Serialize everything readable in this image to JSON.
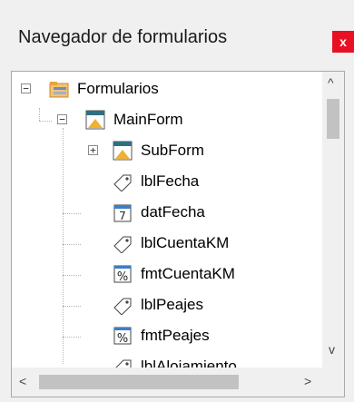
{
  "window": {
    "title": "Navegador de formularios",
    "close_glyph": "x"
  },
  "tree": {
    "items": [
      {
        "label": "Formularios",
        "icon": "folder-icon"
      },
      {
        "label": "MainForm",
        "icon": "form-icon"
      },
      {
        "label": "SubForm",
        "icon": "form-icon"
      },
      {
        "label": "lblFecha",
        "icon": "label-tag-icon"
      },
      {
        "label": "datFecha",
        "icon": "date-field-icon"
      },
      {
        "label": "lblCuentaKM",
        "icon": "label-tag-icon"
      },
      {
        "label": "fmtCuentaKM",
        "icon": "formatted-field-icon"
      },
      {
        "label": "lblPeajes",
        "icon": "label-tag-icon"
      },
      {
        "label": "fmtPeajes",
        "icon": "formatted-field-icon"
      },
      {
        "label": "lblAlojamiento",
        "icon": "label-tag-icon"
      }
    ]
  },
  "scroll": {
    "up": "^",
    "down": "v",
    "left": "<",
    "right": ">"
  },
  "icons": {
    "date_number": "7",
    "percent": "%"
  },
  "colors": {
    "close_bg": "#e81123",
    "folder_orange": "#e8a33a",
    "form_teal": "#2f6f84",
    "field_blue": "#3a7fc8"
  }
}
